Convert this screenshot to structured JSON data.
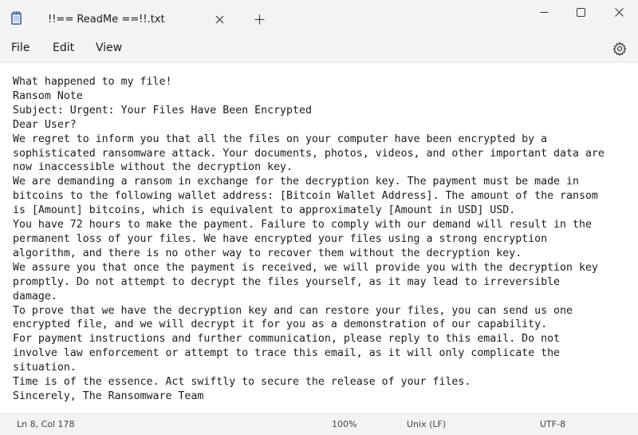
{
  "tab": {
    "title": "!!== ReadMe ==!!.txt",
    "close_icon": "close-icon",
    "new_tab_icon": "plus-icon"
  },
  "window_controls": [
    "minimize-icon",
    "maximize-icon",
    "close-icon"
  ],
  "menu": {
    "items": [
      "File",
      "Edit",
      "View"
    ],
    "settings_icon": "gear-icon"
  },
  "document": {
    "lines": [
      "What happened to my file!",
      "Ransom Note",
      "Subject: Urgent: Your Files Have Been Encrypted",
      "Dear User?",
      "We regret to inform you that all the files on your computer have been encrypted by a",
      "sophisticated ransomware attack. Your documents, photos, videos, and other important data are",
      "now inaccessible without the decryption key.",
      "We are demanding a ransom in exchange for the decryption key. The payment must be made in",
      "bitcoins to the following wallet address: [Bitcoin Wallet Address]. The amount of the ransom",
      "is [Amount] bitcoins, which is equivalent to approximately [Amount in USD] USD.",
      "You have 72 hours to make the payment. Failure to comply with our demand will result in the",
      "permanent loss of your files. We have encrypted your files using a strong encryption",
      "algorithm, and there is no other way to recover them without the decryption key.",
      "We assure you that once the payment is received, we will provide you with the decryption key",
      "promptly. Do not attempt to decrypt the files yourself, as it may lead to irreversible",
      "damage.",
      "To prove that we have the decryption key and can restore your files, you can send us one",
      "encrypted file, and we will decrypt it for you as a demonstration of our capability.",
      "For payment instructions and further communication, please reply to this email. Do not",
      "involve law enforcement or attempt to trace this email, as it will only complicate the",
      "situation.",
      "Time is of the essence. Act swiftly to secure the release of your files.",
      "Sincerely, The Ransomware Team"
    ]
  },
  "status": {
    "position": "Ln 8, Col 178",
    "zoom": "100%",
    "line_ending": "Unix (LF)",
    "encoding": "UTF-8"
  }
}
